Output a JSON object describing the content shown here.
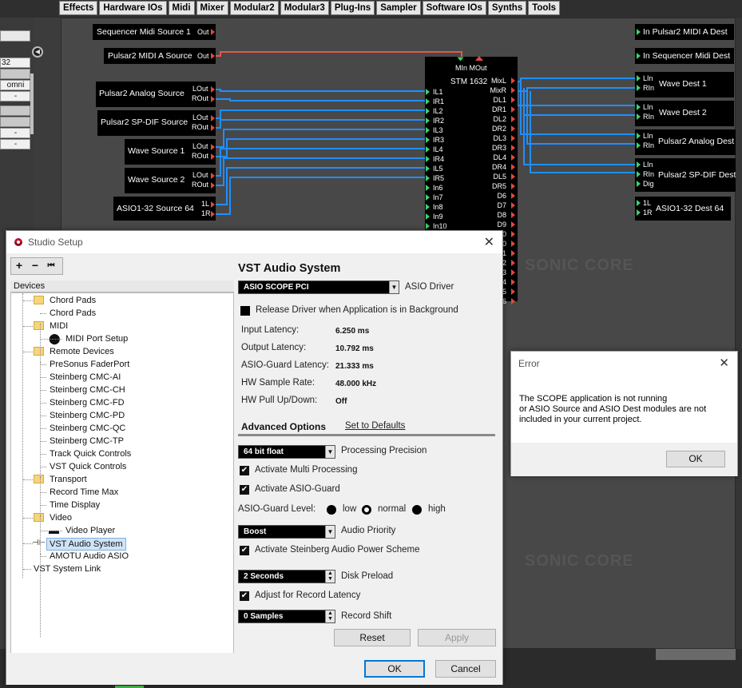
{
  "menu": [
    "Effects",
    "Hardware IOs",
    "Midi",
    "Mixer",
    "Modular2",
    "Modular3",
    "Plug-Ins",
    "Sampler",
    "Software IOs",
    "Synths",
    "Tools"
  ],
  "left_strip": {
    "field1": "32",
    "field2": "omni",
    "field3": "-",
    "field4": "-"
  },
  "routing": {
    "sources": [
      {
        "name": "Sequencer Midi Source 1",
        "ports": [
          "Out"
        ]
      },
      {
        "name": "Pulsar2 MIDI A Source",
        "ports": [
          "Out"
        ]
      },
      {
        "name": "Pulsar2 Analog Source",
        "ports": [
          "LOut",
          "ROut"
        ]
      },
      {
        "name": "Pulsar2 SP-DIF Source",
        "ports": [
          "LOut",
          "ROut"
        ]
      },
      {
        "name": "Wave Source 1",
        "ports": [
          "LOut",
          "ROut"
        ]
      },
      {
        "name": "Wave Source 2",
        "ports": [
          "LOut",
          "ROut"
        ]
      },
      {
        "name": "ASIO1-32 Source 64",
        "ports": [
          "1L",
          "1R"
        ]
      }
    ],
    "mixer": {
      "name": "STM 1632",
      "top_ports": "MIn MOut",
      "inputs": [
        "IL1",
        "IR1",
        "IL2",
        "IR2",
        "IL3",
        "IR3",
        "IL4",
        "IR4",
        "IL5",
        "IR5",
        "In6",
        "In7",
        "In8",
        "In9",
        "In10"
      ],
      "outputs": [
        "MixL",
        "MixR",
        "DL1",
        "DR1",
        "DL2",
        "DR2",
        "DL3",
        "DR3",
        "DL4",
        "DR4",
        "DL5",
        "DR5",
        "D6",
        "D7",
        "D8",
        "D9",
        "D10",
        "0",
        "1",
        "2",
        "3",
        "4",
        "5",
        "6"
      ]
    },
    "dests": [
      {
        "name": "In Pulsar2 MIDI A Dest"
      },
      {
        "name": "In Sequencer Midi Dest"
      },
      {
        "name": "Wave Dest 1",
        "ports": [
          "LIn",
          "RIn"
        ]
      },
      {
        "name": "Wave Dest 2",
        "ports": [
          "LIn",
          "RIn"
        ]
      },
      {
        "name": "Pulsar2 Analog Dest",
        "ports": [
          "LIn",
          "RIn"
        ]
      },
      {
        "name": "Pulsar2 SP-DIF Dest",
        "ports": [
          "LIn",
          "RIn",
          "Dig"
        ]
      },
      {
        "name": "ASIO1-32 Dest 64",
        "ports": [
          "1L",
          "1R"
        ]
      }
    ],
    "watermark1": "SONIC CORE",
    "watermark2": "SONIC CORE",
    "colors": {
      "midi_wire": "#e05a48",
      "audio_wire": "#1f8fff",
      "port_out": "#e04a3a",
      "port_in": "#3bd36a"
    }
  },
  "studio_setup": {
    "title": "Studio Setup",
    "toolbar": [
      "+",
      "−",
      "⏮"
    ],
    "devices_header": "Devices",
    "tree": [
      {
        "label": "Chord Pads",
        "type": "folder",
        "level": 0
      },
      {
        "label": "Chord Pads",
        "type": "item",
        "level": 1
      },
      {
        "label": "MIDI",
        "type": "folder",
        "level": 0
      },
      {
        "label": "MIDI Port Setup",
        "type": "midi",
        "level": 1
      },
      {
        "label": "Remote Devices",
        "type": "folder",
        "level": 0
      },
      {
        "label": "PreSonus FaderPort",
        "type": "item",
        "level": 1
      },
      {
        "label": "Steinberg CMC-AI",
        "type": "item",
        "level": 1
      },
      {
        "label": "Steinberg CMC-CH",
        "type": "item",
        "level": 1
      },
      {
        "label": "Steinberg CMC-FD",
        "type": "item",
        "level": 1
      },
      {
        "label": "Steinberg CMC-PD",
        "type": "item",
        "level": 1
      },
      {
        "label": "Steinberg CMC-QC",
        "type": "item",
        "level": 1
      },
      {
        "label": "Steinberg CMC-TP",
        "type": "item",
        "level": 1
      },
      {
        "label": "Track Quick Controls",
        "type": "item",
        "level": 1
      },
      {
        "label": "VST Quick Controls",
        "type": "item",
        "level": 1
      },
      {
        "label": "Transport",
        "type": "folder",
        "level": 0
      },
      {
        "label": "Record Time Max",
        "type": "item",
        "level": 1
      },
      {
        "label": "Time Display",
        "type": "item",
        "level": 1
      },
      {
        "label": "Video",
        "type": "folder",
        "level": 0
      },
      {
        "label": "Video Player",
        "type": "video",
        "level": 1
      },
      {
        "label": "VST Audio System",
        "type": "audio",
        "level": 0,
        "selected": true
      },
      {
        "label": "AMOTU Audio ASIO",
        "type": "item",
        "level": 1
      },
      {
        "label": "VST System Link",
        "type": "root",
        "level": -1
      }
    ],
    "panel": {
      "heading": "VST Audio System",
      "asio_driver_value": "ASIO SCOPE PCI",
      "asio_driver_label": "ASIO Driver",
      "release_driver_label": "Release Driver when Application is in Background",
      "input_latency_label": "Input Latency:",
      "input_latency": "6.250 ms",
      "output_latency_label": "Output Latency:",
      "output_latency": "10.792 ms",
      "guard_latency_label": "ASIO-Guard Latency:",
      "guard_latency": "21.333 ms",
      "sample_rate_label": "HW Sample Rate:",
      "sample_rate": "48.000 kHz",
      "pull_label": "HW Pull Up/Down:",
      "pull": "Off",
      "advanced_tab": "Advanced Options",
      "defaults_tab": "Set to Defaults",
      "precision_value": "64 bit float",
      "precision_label": "Processing Precision",
      "multi_processing": "Activate Multi Processing",
      "asio_guard": "Activate ASIO-Guard",
      "guard_level_label": "ASIO-Guard Level:",
      "guard_levels": [
        "low",
        "normal",
        "high"
      ],
      "priority_value": "Boost",
      "priority_label": "Audio Priority",
      "power_scheme": "Activate Steinberg Audio Power Scheme",
      "disk_preload_value": "2 Seconds",
      "disk_preload_label": "Disk Preload",
      "adjust_latency": "Adjust for Record Latency",
      "record_shift_value": "0 Samples",
      "record_shift_label": "Record Shift",
      "reset": "Reset",
      "apply": "Apply"
    },
    "ok": "OK",
    "cancel": "Cancel"
  },
  "error_dialog": {
    "title": "Error",
    "message_line1": "The SCOPE application is not running",
    "message_line2": "or ASIO Source and ASIO Dest modules are not",
    "message_line3": "included in your current project.",
    "ok": "OK"
  }
}
